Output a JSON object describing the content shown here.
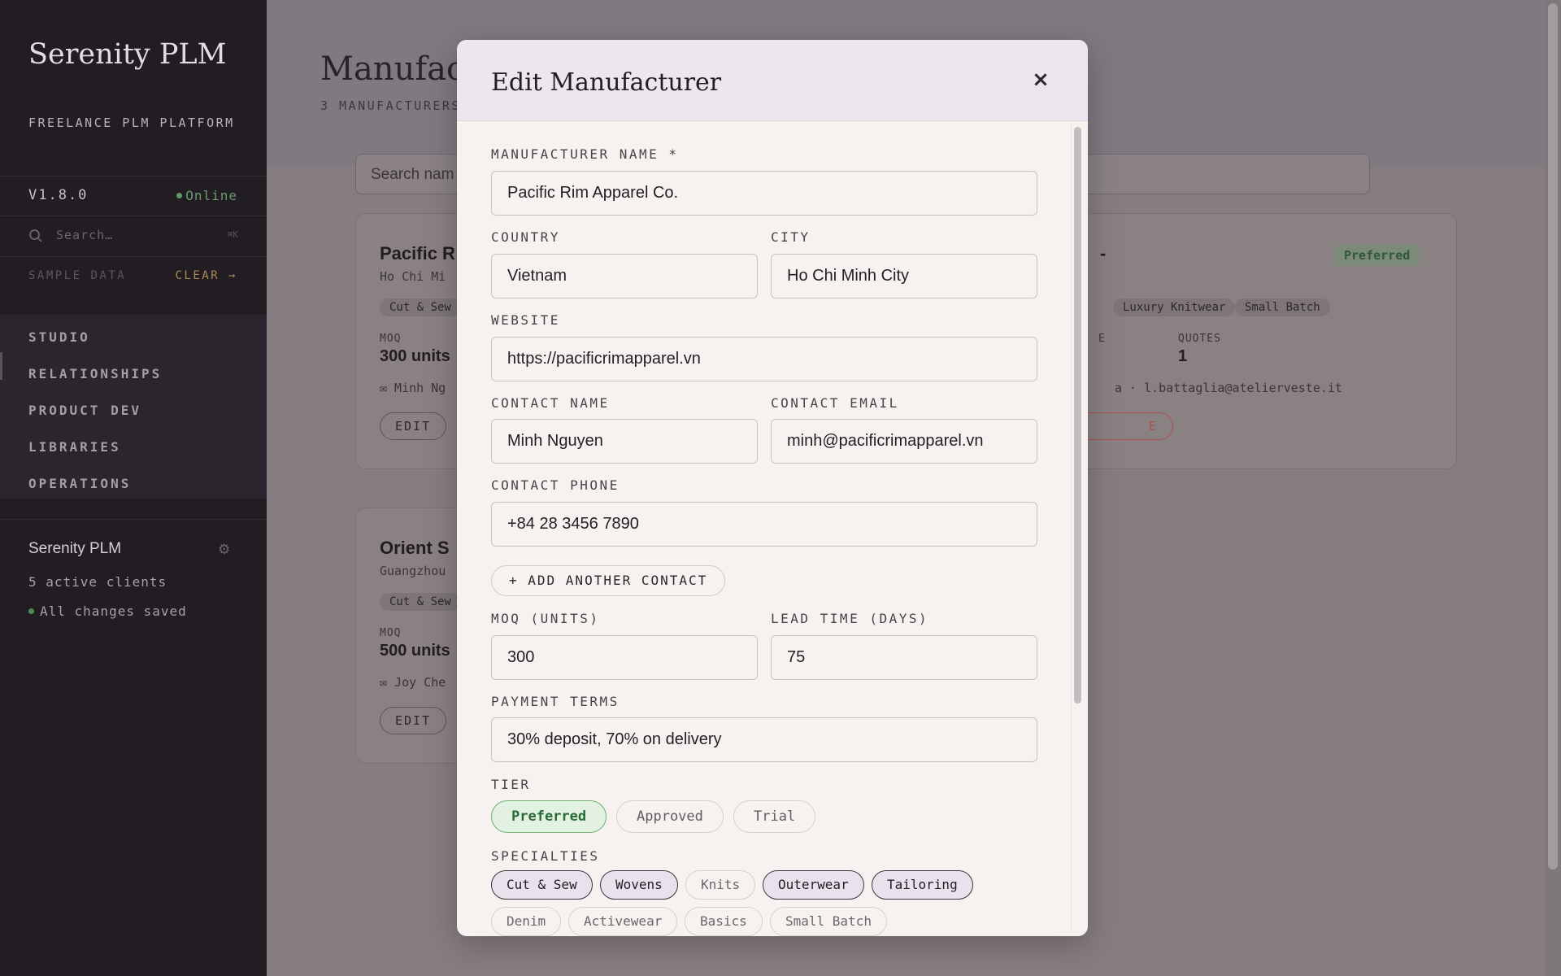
{
  "sidebar": {
    "brand": "Serenity PLM",
    "brand_sub": "FREELANCE PLM PLATFORM",
    "version": "V1.8.0",
    "status": "Online",
    "search_placeholder": "Search…",
    "search_shortcut": "⌘K",
    "sample_label": "SAMPLE DATA",
    "sample_clear": "CLEAR →",
    "nav": [
      "STUDIO",
      "RELATIONSHIPS",
      "PRODUCT DEV",
      "LIBRARIES",
      "OPERATIONS"
    ],
    "workspace_name": "Serenity PLM",
    "workspace_clients": "5 active clients",
    "workspace_saved": "All changes saved"
  },
  "main": {
    "title": "Manufactur",
    "count": "3 MANUFACTURERS",
    "search_placeholder": "Search nam",
    "cards": [
      {
        "name": "Pacific R",
        "location": "Ho Chi Mi",
        "chip": "Cut & Sew",
        "moq_label": "MOQ",
        "moq_value": "300 units",
        "contact": "✉ Minh Ng",
        "edit": "EDIT"
      },
      {
        "name": "Orient S",
        "location": "Guangzhou",
        "chip": "Cut & Sew",
        "moq_label": "MOQ",
        "moq_value": "500 units",
        "contact": "✉ Joy Che",
        "edit": "EDIT"
      },
      {
        "name": "-",
        "badge": "Preferred",
        "chips": [
          "Luxury Knitwear",
          "Small Batch"
        ],
        "lead_label": "E",
        "quotes_label": "QUOTES",
        "quotes_value": "1",
        "contact": "a · l.battaglia@atelierveste.it",
        "remove": "E"
      }
    ]
  },
  "modal": {
    "title": "Edit Manufacturer",
    "close_icon": "×",
    "fields": {
      "name_label": "MANUFACTURER NAME *",
      "name_value": "Pacific Rim Apparel Co.",
      "country_label": "COUNTRY",
      "country_value": "Vietnam",
      "city_label": "CITY",
      "city_value": "Ho Chi Minh City",
      "website_label": "WEBSITE",
      "website_value": "https://pacificrimapparel.vn",
      "contact_name_label": "CONTACT NAME",
      "contact_name_value": "Minh Nguyen",
      "contact_email_label": "CONTACT EMAIL",
      "contact_email_value": "minh@pacificrimapparel.vn",
      "contact_phone_label": "CONTACT PHONE",
      "contact_phone_value": "+84 28 3456 7890",
      "add_contact": "+ ADD ANOTHER CONTACT",
      "moq_label": "MOQ (UNITS)",
      "moq_value": "300",
      "lead_label": "LEAD TIME (DAYS)",
      "lead_value": "75",
      "payment_label": "PAYMENT TERMS",
      "payment_value": "30% deposit, 70% on delivery"
    },
    "tier": {
      "label": "TIER",
      "options": [
        "Preferred",
        "Approved",
        "Trial"
      ],
      "selected": "Preferred"
    },
    "specialties": {
      "label": "SPECIALTIES",
      "options": [
        "Cut & Sew",
        "Wovens",
        "Knits",
        "Outerwear",
        "Tailoring",
        "Denim",
        "Activewear",
        "Basics",
        "Small Batch"
      ],
      "selected": [
        "Cut & Sew",
        "Wovens",
        "Outerwear",
        "Tailoring"
      ]
    }
  },
  "colors": {
    "sidebar_bg": "#221c23",
    "modal_bg": "#f7f2ef",
    "modal_header_bg": "#ece6ee",
    "preferred_green": "#2b6a35",
    "online_green": "#6b9a6e",
    "clear_accent": "#a88a57"
  }
}
